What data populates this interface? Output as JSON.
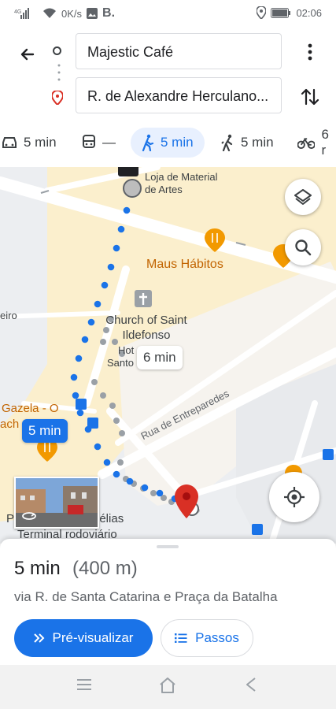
{
  "status_bar": {
    "signal": "4G",
    "speed": "0K/s",
    "time": "02:06"
  },
  "directions": {
    "origin": "Majestic Café",
    "destination": "R. de Alexandre Herculano..."
  },
  "modes": [
    {
      "name": "car",
      "label": "5 min"
    },
    {
      "name": "transit",
      "label": "—"
    },
    {
      "name": "walk",
      "label": "5 min"
    },
    {
      "name": "rideshare",
      "label": "5 min"
    },
    {
      "name": "bike",
      "label": "6 r"
    }
  ],
  "map": {
    "labels": {
      "art_shop": "Loja de Material de Artes",
      "maus_habitos": "Maus Hábitos",
      "church": "Church of Saint Ildefonso",
      "street_left": "eiro",
      "hotel_1": "Hot",
      "hotel_2": "Santo",
      "gazela_1": "Gazela - O",
      "gazela_2": "ach",
      "rua": "Rua de Entreparedes",
      "terminal": "Terminal rodoviário",
      "amelias": "nélias",
      "p_letter": "P"
    },
    "alt_route_time": "6 min",
    "selected_route_time": "5 min"
  },
  "summary": {
    "duration": "5 min",
    "distance": "(400 m)",
    "via": "via R. de Santa Catarina e Praça da Batalha",
    "preview_button": "Pré-visualizar",
    "steps_button": "Passos"
  },
  "colors": {
    "accent": "#1a73e8",
    "pin": "#d93025",
    "food": "#f29900"
  }
}
